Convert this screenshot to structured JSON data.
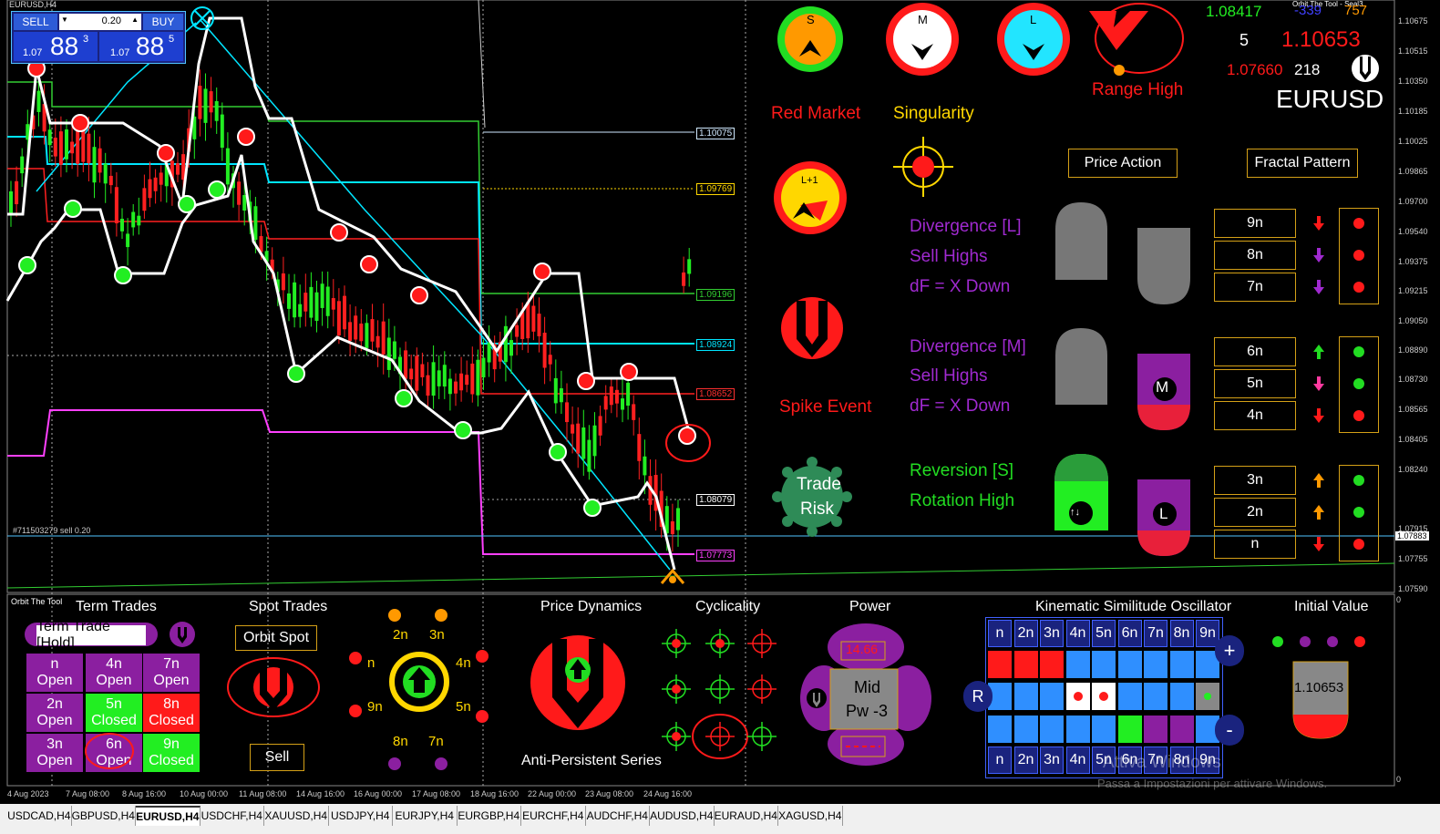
{
  "chart": {
    "symbol_caption": "EURUSD,H4",
    "order_caption": "#711503279 sell 0.20",
    "right_corner": "Orbit The Tool - Seal3",
    "price_labels": [
      {
        "text": "1.10075",
        "color": "#cfe8ff"
      },
      {
        "text": "1.09769",
        "color": "#ffd700"
      },
      {
        "text": "1.09196",
        "color": "#32cd32"
      },
      {
        "text": "1.08924",
        "color": "#00e5ff"
      },
      {
        "text": "1.08652",
        "color": "#ff3030"
      },
      {
        "text": "1.08079",
        "color": "#ffffff"
      },
      {
        "text": "1.07773",
        "color": "#ff40ff"
      }
    ],
    "axis_prices": [
      "1.10675",
      "1.10515",
      "1.10350",
      "1.10185",
      "1.10025",
      "1.09865",
      "1.09700",
      "1.09540",
      "1.09375",
      "1.09215",
      "1.09050",
      "1.08890",
      "1.08730",
      "1.08565",
      "1.08405",
      "1.08240",
      "1.07915",
      "1.07883",
      "1.07755",
      "1.07590"
    ],
    "lower_axis": [
      "0",
      "0"
    ],
    "x_labels": [
      "4 Aug 2023",
      "7 Aug 08:00",
      "8 Aug 16:00",
      "10 Aug 00:00",
      "11 Aug 08:00",
      "14 Aug 16:00",
      "16 Aug 00:00",
      "17 Aug 08:00",
      "18 Aug 16:00",
      "22 Aug 00:00",
      "23 Aug 08:00",
      "24 Aug 16:00"
    ],
    "watermark_1": "Attiva Windows",
    "watermark_2": "Passa a Impostazioni per attivare Windows."
  },
  "trade_panel": {
    "sell_label": "SELL",
    "buy_label": "BUY",
    "lot_value": "0.20",
    "sell_price_prefix": "1.07",
    "sell_price_big": "88",
    "sell_price_sup": "3",
    "buy_price_prefix": "1.07",
    "buy_price_big": "88",
    "buy_price_sup": "5"
  },
  "top_right": {
    "v1": "1.08417",
    "v2": "-339",
    "v3": "757",
    "v4": "5",
    "v5": "1.10653",
    "v6": "1.07660",
    "v7": "218",
    "symbol": "EURUSD"
  },
  "dashboard": {
    "badge_s": "S",
    "badge_m": "M",
    "badge_l": "L",
    "badge_l1": "L+1",
    "range_high": "Range High",
    "red_market": "Red Market",
    "singularity": "Singularity",
    "spike_event": "Spike Event",
    "trade_risk_1": "Trade",
    "trade_risk_2": "Risk",
    "price_action": "Price Action",
    "fractal_pattern": "Fractal Pattern",
    "div_l_title": "Divergence [L]",
    "div_l_sub1": "Sell Highs",
    "div_l_sub2": "dF = X Down",
    "div_m_title": "Divergence [M]",
    "div_m_sub1": "Sell Highs",
    "div_m_sub2": "dF = X Down",
    "rev_title": "Reversion [S]",
    "rev_sub": "Rotation High",
    "m_label": "M",
    "l_label": "L",
    "nboxes": [
      "9n",
      "8n",
      "7n",
      "6n",
      "5n",
      "4n",
      "3n",
      "2n",
      "n"
    ],
    "colors": {
      "red": "#ff1a1a",
      "green": "#22dd22",
      "purple": "#9b30d0",
      "gold": "#d4a017",
      "orange": "#ff9900"
    }
  },
  "bottom": {
    "panel_caption": "Orbit The Tool",
    "term_trades": "Term Trades",
    "term_trade_hold": "Term Trade [Hold]",
    "tt_cells": [
      {
        "n": "n",
        "s": "Open"
      },
      {
        "n": "4n",
        "s": "Open"
      },
      {
        "n": "7n",
        "s": "Open"
      },
      {
        "n": "2n",
        "s": "Open"
      },
      {
        "n": "5n",
        "s": "Closed"
      },
      {
        "n": "8n",
        "s": "Closed"
      },
      {
        "n": "3n",
        "s": "Open"
      },
      {
        "n": "6n",
        "s": "Open"
      },
      {
        "n": "9n",
        "s": "Closed"
      }
    ],
    "spot_trades": "Spot Trades",
    "orbit_spot": "Orbit Spot",
    "sell": "Sell",
    "orbit_labels": [
      "2n",
      "3n",
      "n",
      "4n",
      "9n",
      "5n",
      "8n",
      "7n"
    ],
    "price_dynamics": "Price Dynamics",
    "anti_persistent": "Anti-Persistent Series",
    "cyclicality": "Cyclicality",
    "power": "Power",
    "power_value": "14.66",
    "power_mid_1": "Mid",
    "power_mid_2": "Pw -3",
    "kso_title": "Kinematic Similitude Oscillator",
    "kso_header": [
      "n",
      "2n",
      "3n",
      "4n",
      "5n",
      "6n",
      "7n",
      "8n",
      "9n"
    ],
    "kso_r": "R",
    "kso_plus": "+",
    "kso_minus": "-",
    "initial_value": "Initial Value",
    "initial_price": "1.10653"
  },
  "tabs": [
    "USDCAD,H4",
    "GBPUSD,H4",
    "EURUSD,H4",
    "USDCHF,H4",
    "XAUUSD,H4",
    "USDJPY,H4",
    "EURJPY,H4",
    "EURGBP,H4",
    "EURCHF,H4",
    "AUDCHF,H4",
    "AUDUSD,H4",
    "EURAUD,H4",
    "XAGUSD,H4"
  ],
  "active_tab": "EURUSD,H4"
}
